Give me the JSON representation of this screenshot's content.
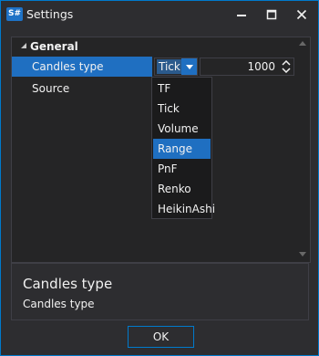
{
  "window": {
    "app_icon_text": "S#",
    "title": "Settings",
    "accent_color": "#007acc",
    "selection_color": "#1f6fc1",
    "buttons": {
      "minimize": "minimize-icon",
      "maximize": "maximize-icon",
      "close": "close-icon"
    }
  },
  "property_grid": {
    "category": "General",
    "rows": [
      {
        "name": "Candles type",
        "selected": true,
        "combo_value": "Tick",
        "numeric_value": "1000"
      },
      {
        "name": "Source",
        "selected": false
      }
    ],
    "dropdown": {
      "options": [
        "TF",
        "Tick",
        "Volume",
        "Range",
        "PnF",
        "Renko",
        "HeikinAshi"
      ],
      "highlighted": "Range"
    }
  },
  "description": {
    "title": "Candles type",
    "text": "Candles type"
  },
  "footer": {
    "ok_label": "OK"
  }
}
